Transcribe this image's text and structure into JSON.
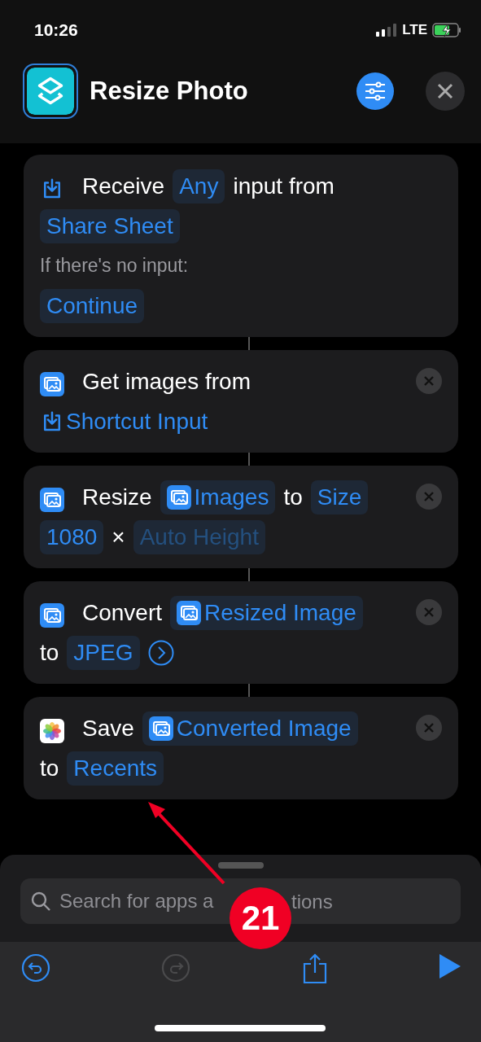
{
  "status_bar": {
    "time": "10:26",
    "network": "LTE"
  },
  "header": {
    "title": "Resize Photo"
  },
  "actions": [
    {
      "kind": "receive",
      "removable": false,
      "lines": [
        [
          {
            "kind": "word",
            "text": "Receive"
          },
          {
            "kind": "pill",
            "text": "Any"
          },
          {
            "kind": "word",
            "text": "input from"
          }
        ],
        [
          {
            "kind": "pill",
            "text": "Share Sheet"
          }
        ],
        [
          {
            "kind": "note",
            "text": "If there's no input:"
          }
        ],
        [
          {
            "kind": "pill",
            "text": "Continue"
          }
        ]
      ]
    },
    {
      "kind": "images",
      "removable": true,
      "lines": [
        [
          {
            "kind": "word",
            "text": "Get images from"
          }
        ],
        [
          {
            "kind": "variable",
            "text": "Shortcut Input"
          }
        ]
      ]
    },
    {
      "kind": "images",
      "removable": true,
      "lines": [
        [
          {
            "kind": "word",
            "text": "Resize"
          },
          {
            "kind": "image_pill",
            "text": "Images"
          },
          {
            "kind": "word",
            "text": "to"
          },
          {
            "kind": "pill",
            "text": "Size"
          }
        ],
        [
          {
            "kind": "pill",
            "text": "1080"
          },
          {
            "kind": "word",
            "text": "×"
          },
          {
            "kind": "placeholder",
            "text": "Auto Height"
          }
        ]
      ]
    },
    {
      "kind": "images",
      "removable": true,
      "lines": [
        [
          {
            "kind": "word",
            "text": "Convert"
          },
          {
            "kind": "image_pill",
            "text": "Resized Image"
          }
        ],
        [
          {
            "kind": "word",
            "text": "to"
          },
          {
            "kind": "pill",
            "text": "JPEG"
          },
          {
            "kind": "chevron"
          }
        ]
      ]
    },
    {
      "kind": "photos",
      "removable": true,
      "lines": [
        [
          {
            "kind": "word",
            "text": "Save"
          },
          {
            "kind": "image_pill",
            "text": "Converted Image"
          }
        ],
        [
          {
            "kind": "word",
            "text": "to"
          },
          {
            "kind": "pill",
            "text": "Recents"
          }
        ]
      ]
    }
  ],
  "search": {
    "placeholder": "Search for apps a",
    "placeholder_tail": "tions"
  },
  "toolbar": [
    {
      "kind": "undo",
      "disabled": false
    },
    {
      "kind": "redo",
      "disabled": true
    },
    {
      "kind": "share",
      "disabled": false
    },
    {
      "kind": "play",
      "disabled": false
    }
  ],
  "annotation": {
    "badge": "21"
  }
}
